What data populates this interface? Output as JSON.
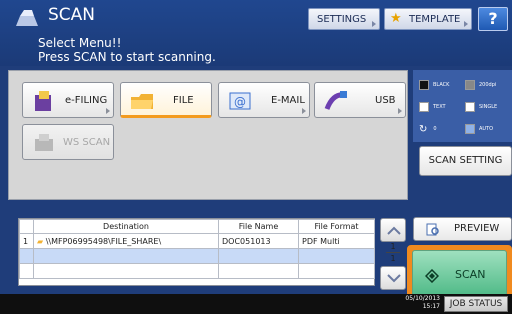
{
  "header": {
    "title": "SCAN",
    "settings_label": "SETTINGS",
    "template_label": "TEMPLATE",
    "help_label": "?"
  },
  "message": {
    "line1": "Select Menu!!",
    "line2": "Press SCAN to start scanning."
  },
  "functions": [
    {
      "label": "e-FILING",
      "icon": "e-filing-icon",
      "state": "normal"
    },
    {
      "label": "FILE",
      "icon": "folder-icon",
      "state": "selected"
    },
    {
      "label": "E-MAIL",
      "icon": "email-icon",
      "state": "normal"
    },
    {
      "label": "USB",
      "icon": "usb-icon",
      "state": "normal"
    },
    {
      "label": "WS SCAN",
      "icon": "ws-scan-icon",
      "state": "disabled"
    }
  ],
  "scan_status": {
    "color_mode": "BLACK",
    "resolution": "200dpi",
    "original_mode": "TEXT",
    "duplex": "SINGLE",
    "rotation": "0",
    "size": "AUTO"
  },
  "scan_setting_label": "SCAN SETTING",
  "table": {
    "headers": [
      "",
      "Destination",
      "File Name",
      "File Format"
    ],
    "rows": [
      {
        "num": "1",
        "destination": "\\\\MFP06995498\\FILE_SHARE\\",
        "file_name": "DOC051013",
        "file_format": "PDF Multi"
      }
    ]
  },
  "pager": {
    "current": "1",
    "total": "1"
  },
  "preview_label": "PREVIEW",
  "scan_label": "SCAN",
  "bottom": {
    "date": "05/10/2013",
    "time": "15:17",
    "job_status_label": "JOB STATUS"
  },
  "colors": {
    "header_bg": "#20478f",
    "accent_orange": "#f08a1f",
    "scan_green": "#49b783",
    "row_selected": "#c8daf7"
  }
}
